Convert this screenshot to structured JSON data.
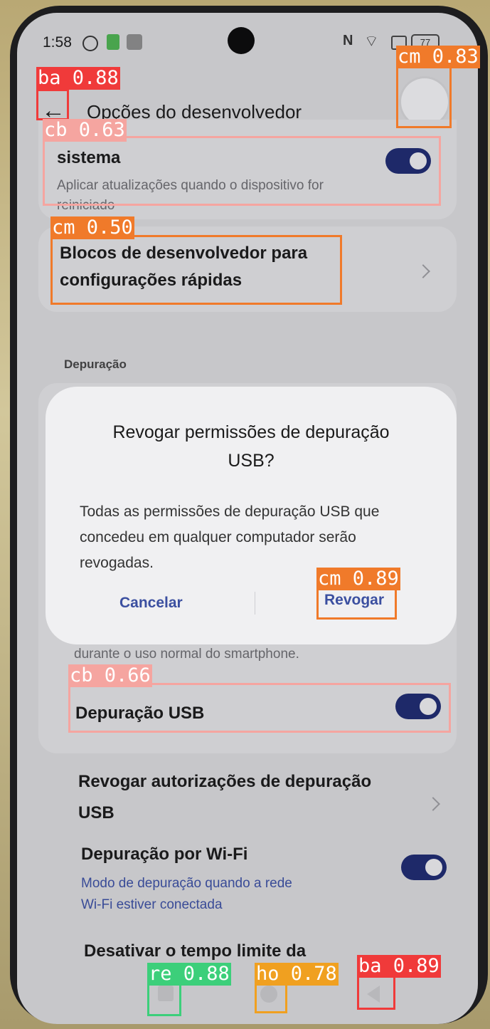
{
  "status_bar": {
    "time": "1:58",
    "battery": "77"
  },
  "header": {
    "back_icon": "arrow-left-icon",
    "title": "Opções do desenvolvedor"
  },
  "settings": {
    "system_update": {
      "title": "sistema",
      "subtitle_line1": "Aplicar atualizações quando o dispositivo for",
      "subtitle_line2": "reiniciado",
      "toggle_on": true
    },
    "quick_tiles": {
      "line1": "Blocos de desenvolvedor para",
      "line2": "configurações rápidas"
    },
    "section_debug": "Depuração",
    "usb_desc_tail": "durante o uso normal do smartphone.",
    "usb_debugging": {
      "title": "Depuração USB",
      "toggle_on": true
    },
    "revoke_auth": {
      "line1": "Revogar autorizações de depuração",
      "line2": "USB"
    },
    "wifi_debugging": {
      "title": "Depuração por Wi-Fi",
      "subtitle_line1": "Modo de depuração quando a rede",
      "subtitle_line2": "Wi-Fi estiver conectada",
      "toggle_on": true
    },
    "timeout": {
      "title": "Desativar o tempo limite da"
    }
  },
  "dialog": {
    "title_line1": "Revogar permissões de depuração",
    "title_line2": "USB?",
    "body_line1": "Todas as permissões de depuração USB que",
    "body_line2": "concedeu em qualquer computador serão",
    "body_line3": "revogadas.",
    "cancel_label": "Cancelar",
    "confirm_label": "Revogar"
  },
  "detections": [
    {
      "label": "ba 0.88",
      "color": "#f03a3a"
    },
    {
      "label": "cm 0.83",
      "color": "#f07a2a"
    },
    {
      "label": "cb 0.63",
      "color": "#f5a5a0"
    },
    {
      "label": "cm 0.50",
      "color": "#f07a2a"
    },
    {
      "label": "cm 0.89",
      "color": "#f07a2a"
    },
    {
      "label": "cb 0.66",
      "color": "#f5a5a0"
    },
    {
      "label": "re 0.88",
      "color": "#3ccf7a"
    },
    {
      "label": "ho 0.78",
      "color": "#f0a020"
    },
    {
      "label": "ba 0.89",
      "color": "#f03a3a"
    }
  ],
  "colors": {
    "accent": "#1e2a6e",
    "link": "#3b4fa0"
  }
}
